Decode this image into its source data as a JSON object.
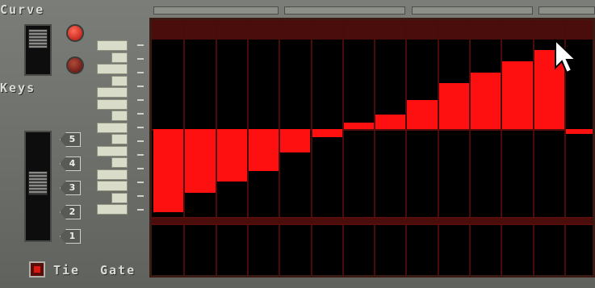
{
  "labels": {
    "curve": "Curve",
    "keys": "Keys",
    "tie": "Tie",
    "gate": "Gate"
  },
  "octaves": [
    "5",
    "4",
    "3",
    "2",
    "1"
  ],
  "bars": [
    -0.94,
    -0.72,
    -0.59,
    -0.47,
    -0.26,
    -0.09,
    0.07,
    0.16,
    0.33,
    0.52,
    0.64,
    0.76,
    0.89,
    -0.05
  ],
  "colors": {
    "bar": "#ff1010",
    "background": "#000000",
    "grid": "#4a0b0a",
    "panel": "#6f716c"
  }
}
